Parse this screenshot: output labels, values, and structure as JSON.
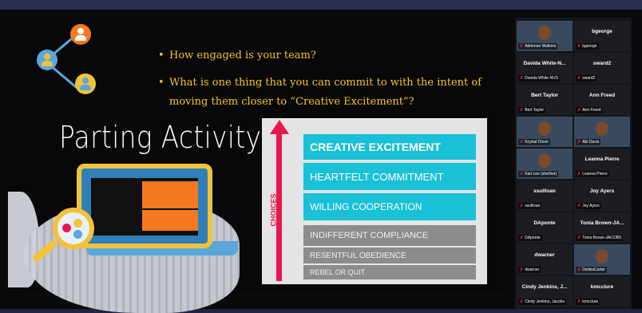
{
  "slide": {
    "title": "Parting Activity",
    "bullets": [
      "How engaged is your team?",
      "What is one thing that you can commit to with the intent of moving them closer to “Creative Excitement”?"
    ],
    "pyramid": {
      "axis_label": "CHOICES",
      "levels": [
        "CREATIVE EXCITEMENT",
        "HEARTFELT COMMITMENT",
        "WILLING COOPERATION",
        "INDIFFERENT COMPLIANCE",
        "RESENTFUL OBEDIENCE",
        "REBEL OR QUIT"
      ]
    },
    "colors": {
      "accent_yellow": "#f3c623",
      "teal": "#19c0d6",
      "arrow": "#e8184f"
    }
  },
  "participants": [
    {
      "name": "",
      "label": "Adrienne Watkins",
      "has_video": true
    },
    {
      "name": "bgeorge",
      "label": "bgeorge",
      "has_video": false
    },
    {
      "name": "Davida White-N...",
      "label": "Davida White-NVS",
      "has_video": false
    },
    {
      "name": "sward2",
      "label": "sward2",
      "has_video": false
    },
    {
      "name": "Bert Taylor",
      "label": "Bert Taylor",
      "has_video": false
    },
    {
      "name": "Ann Freed",
      "label": "Ann Freed",
      "has_video": false
    },
    {
      "name": "",
      "label": "Krystal Dixon",
      "has_video": true
    },
    {
      "name": "",
      "label": "Abi Davis",
      "has_video": true
    },
    {
      "name": "",
      "label": "Kari Lee (she/her)",
      "has_video": true
    },
    {
      "name": "Leanna Pierre",
      "label": "Leanna Pierre",
      "has_video": false
    },
    {
      "name": "ssullivan",
      "label": "ssullivan",
      "has_video": false
    },
    {
      "name": "Joy Ayers",
      "label": "Joy Ayers",
      "has_video": false
    },
    {
      "name": "DAponte",
      "label": "DAponte",
      "has_video": false
    },
    {
      "name": "Tonia Brown-JA...",
      "label": "Tonia Brown-JACOBS",
      "has_video": false
    },
    {
      "name": "dwarner",
      "label": "dwarner",
      "has_video": false
    },
    {
      "name": "",
      "label": "DeidraCarter",
      "has_video": true
    },
    {
      "name": "Cindy Jenkins, J...",
      "label": "Cindy Jenkins, Jacobs",
      "has_video": false
    },
    {
      "name": "kmcclure",
      "label": "kmcclure",
      "has_video": false
    }
  ]
}
